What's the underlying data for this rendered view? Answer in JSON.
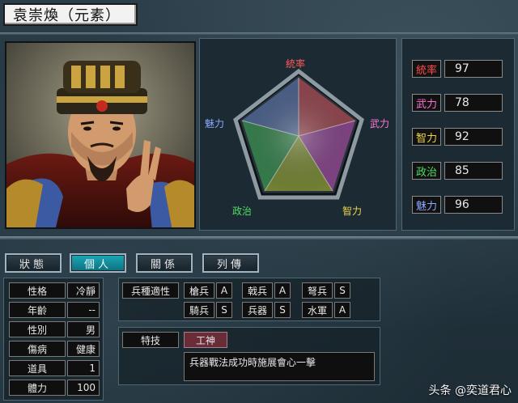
{
  "title": "袁崇煥（元素）",
  "radar": {
    "labels": {
      "top": "統率",
      "right": "武力",
      "bottom_right": "智力",
      "bottom_left": "政治",
      "left": "魅力"
    }
  },
  "stats": [
    {
      "label": "統率",
      "value": "97",
      "color": "#ff4d4d"
    },
    {
      "label": "武力",
      "value": "78",
      "color": "#ff6fd1"
    },
    {
      "label": "智力",
      "value": "92",
      "color": "#f2d34a"
    },
    {
      "label": "政治",
      "value": "85",
      "color": "#4fdc64"
    },
    {
      "label": "魅力",
      "value": "96",
      "color": "#8ca8ff"
    }
  ],
  "tabs": [
    {
      "label": "狀態",
      "active": false
    },
    {
      "label": "個人",
      "active": true
    },
    {
      "label": "關係",
      "active": false
    },
    {
      "label": "列傳",
      "active": false
    }
  ],
  "attributes": [
    {
      "label": "性格",
      "value": "冷靜"
    },
    {
      "label": "年齡",
      "value": "--"
    },
    {
      "label": "性別",
      "value": "男"
    },
    {
      "label": "傷病",
      "value": "健康"
    },
    {
      "label": "道具",
      "value": "1"
    },
    {
      "label": "體力",
      "value": "100"
    }
  ],
  "troops": {
    "header": "兵種適性",
    "rows": [
      [
        {
          "type": "槍兵",
          "grade": "A"
        },
        {
          "type": "戟兵",
          "grade": "A"
        },
        {
          "type": "弩兵",
          "grade": "S"
        }
      ],
      [
        {
          "type": "騎兵",
          "grade": "S"
        },
        {
          "type": "兵器",
          "grade": "S"
        },
        {
          "type": "水軍",
          "grade": "A"
        }
      ]
    ]
  },
  "skill": {
    "header": "特技",
    "name": "工神",
    "description": "兵器戰法成功時施展會心一擊"
  },
  "watermark": "头条 @奕道君心"
}
